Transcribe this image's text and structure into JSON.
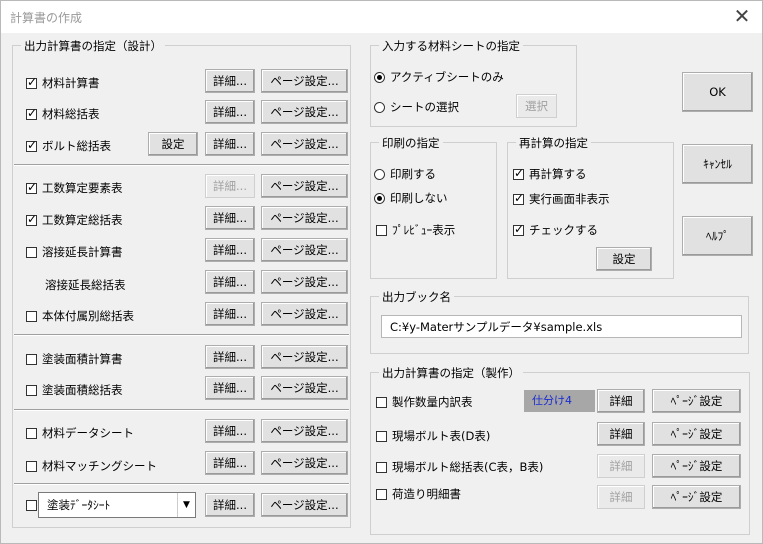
{
  "window": {
    "title": "計算書の作成",
    "close": "✕"
  },
  "design": {
    "label": "出力計算書の指定（設計）",
    "rows": {
      "material_calc": "材料計算書",
      "material_summary": "材料総括表",
      "bolt_summary": "ボルト総括表",
      "labor_element": "工数算定要素表",
      "labor_summary": "工数算定総括表",
      "weld_length_calc": "溶接延長計算書",
      "weld_length_summary": "溶接延長総括表",
      "body_fitting": "本体付属別総括表",
      "paint_area_calc": "塗装面積計算書",
      "paint_area_summary": "塗装面積総括表",
      "material_data": "材料データシート",
      "material_matching": "材料マッチングシート"
    },
    "combo_value": "塗装ﾃﾞｰﾀｼｰﾄ"
  },
  "buttons": {
    "detail": "詳細...",
    "page_setup": "ページ設定...",
    "setting": "設定",
    "select": "選択",
    "ok": "OK",
    "cancel": "ｷｬﾝｾﾙ",
    "help": "ﾍﾙﾌﾟ",
    "detail_plain": "詳細",
    "page_setup_plain": "ﾍﾟｰｼﾞ設定"
  },
  "input_sheet": {
    "label": "入力する材料シートの指定",
    "active_only": "アクティブシートのみ",
    "select_sheet": "シートの選択"
  },
  "print": {
    "label": "印刷の指定",
    "print_yes": "印刷する",
    "print_no": "印刷しない",
    "preview": "ﾌﾟﾚﾋﾞｭｰ表示"
  },
  "recalc": {
    "label": "再計算の指定",
    "recalc": "再計算する",
    "hide_screen": "実行画面非表示",
    "check": "チェックする"
  },
  "output_book": {
    "label": "出力ブック名",
    "path": "C:¥y-Materサンプルデータ¥sample.xls"
  },
  "production": {
    "label": "出力計算書の指定（製作）",
    "tag": "仕分け4",
    "rows": {
      "qty_breakdown": "製作数量内訳表",
      "site_bolt_d": "現場ボルト表(D表)",
      "site_bolt_summary": "現場ボルト総括表(C表，B表)",
      "packing_list": "荷造り明細書"
    }
  },
  "colors": {
    "tag_bg": "#a7a7a7",
    "tag_text": "#1a2bd0",
    "disabled_text": "#a0a0a0"
  }
}
